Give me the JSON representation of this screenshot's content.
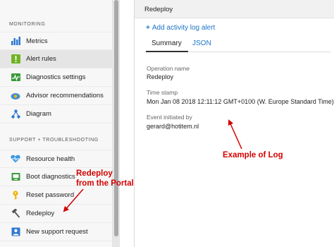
{
  "sidebar": {
    "monitoring_title": "MONITORING",
    "monitoring_items": [
      {
        "label": "Metrics",
        "icon": "bar-chart-icon"
      },
      {
        "label": "Alert rules",
        "icon": "alert-bell-icon"
      },
      {
        "label": "Diagnostics settings",
        "icon": "diagnostics-icon"
      },
      {
        "label": "Advisor recommendations",
        "icon": "advisor-cloud-icon"
      },
      {
        "label": "Diagram",
        "icon": "diagram-icon"
      }
    ],
    "support_title": "SUPPORT + TROUBLESHOOTING",
    "support_items": [
      {
        "label": "Resource health",
        "icon": "heart-icon"
      },
      {
        "label": "Boot diagnostics",
        "icon": "boot-diagnostics-icon"
      },
      {
        "label": "Reset password",
        "icon": "key-icon"
      },
      {
        "label": "Redeploy",
        "icon": "hammer-icon"
      },
      {
        "label": "New support request",
        "icon": "support-person-icon"
      }
    ]
  },
  "blade": {
    "title": "Redeploy",
    "add_link": "Add activity log alert",
    "tabs": [
      "Summary",
      "JSON"
    ],
    "fields": [
      {
        "label": "Operation name",
        "value": "Redeploy"
      },
      {
        "label": "Time stamp",
        "value": "Mon Jan 08 2018 12:11:12 GMT+0100 (W. Europe Standard Time)"
      },
      {
        "label": "Event initiated by",
        "value": "gerard@hotitem.nl"
      }
    ]
  },
  "annotations": {
    "redeploy_line1": "Redeploy",
    "redeploy_line2": "from the Portal",
    "example_log": "Example of Log",
    "color": "#d40000"
  }
}
